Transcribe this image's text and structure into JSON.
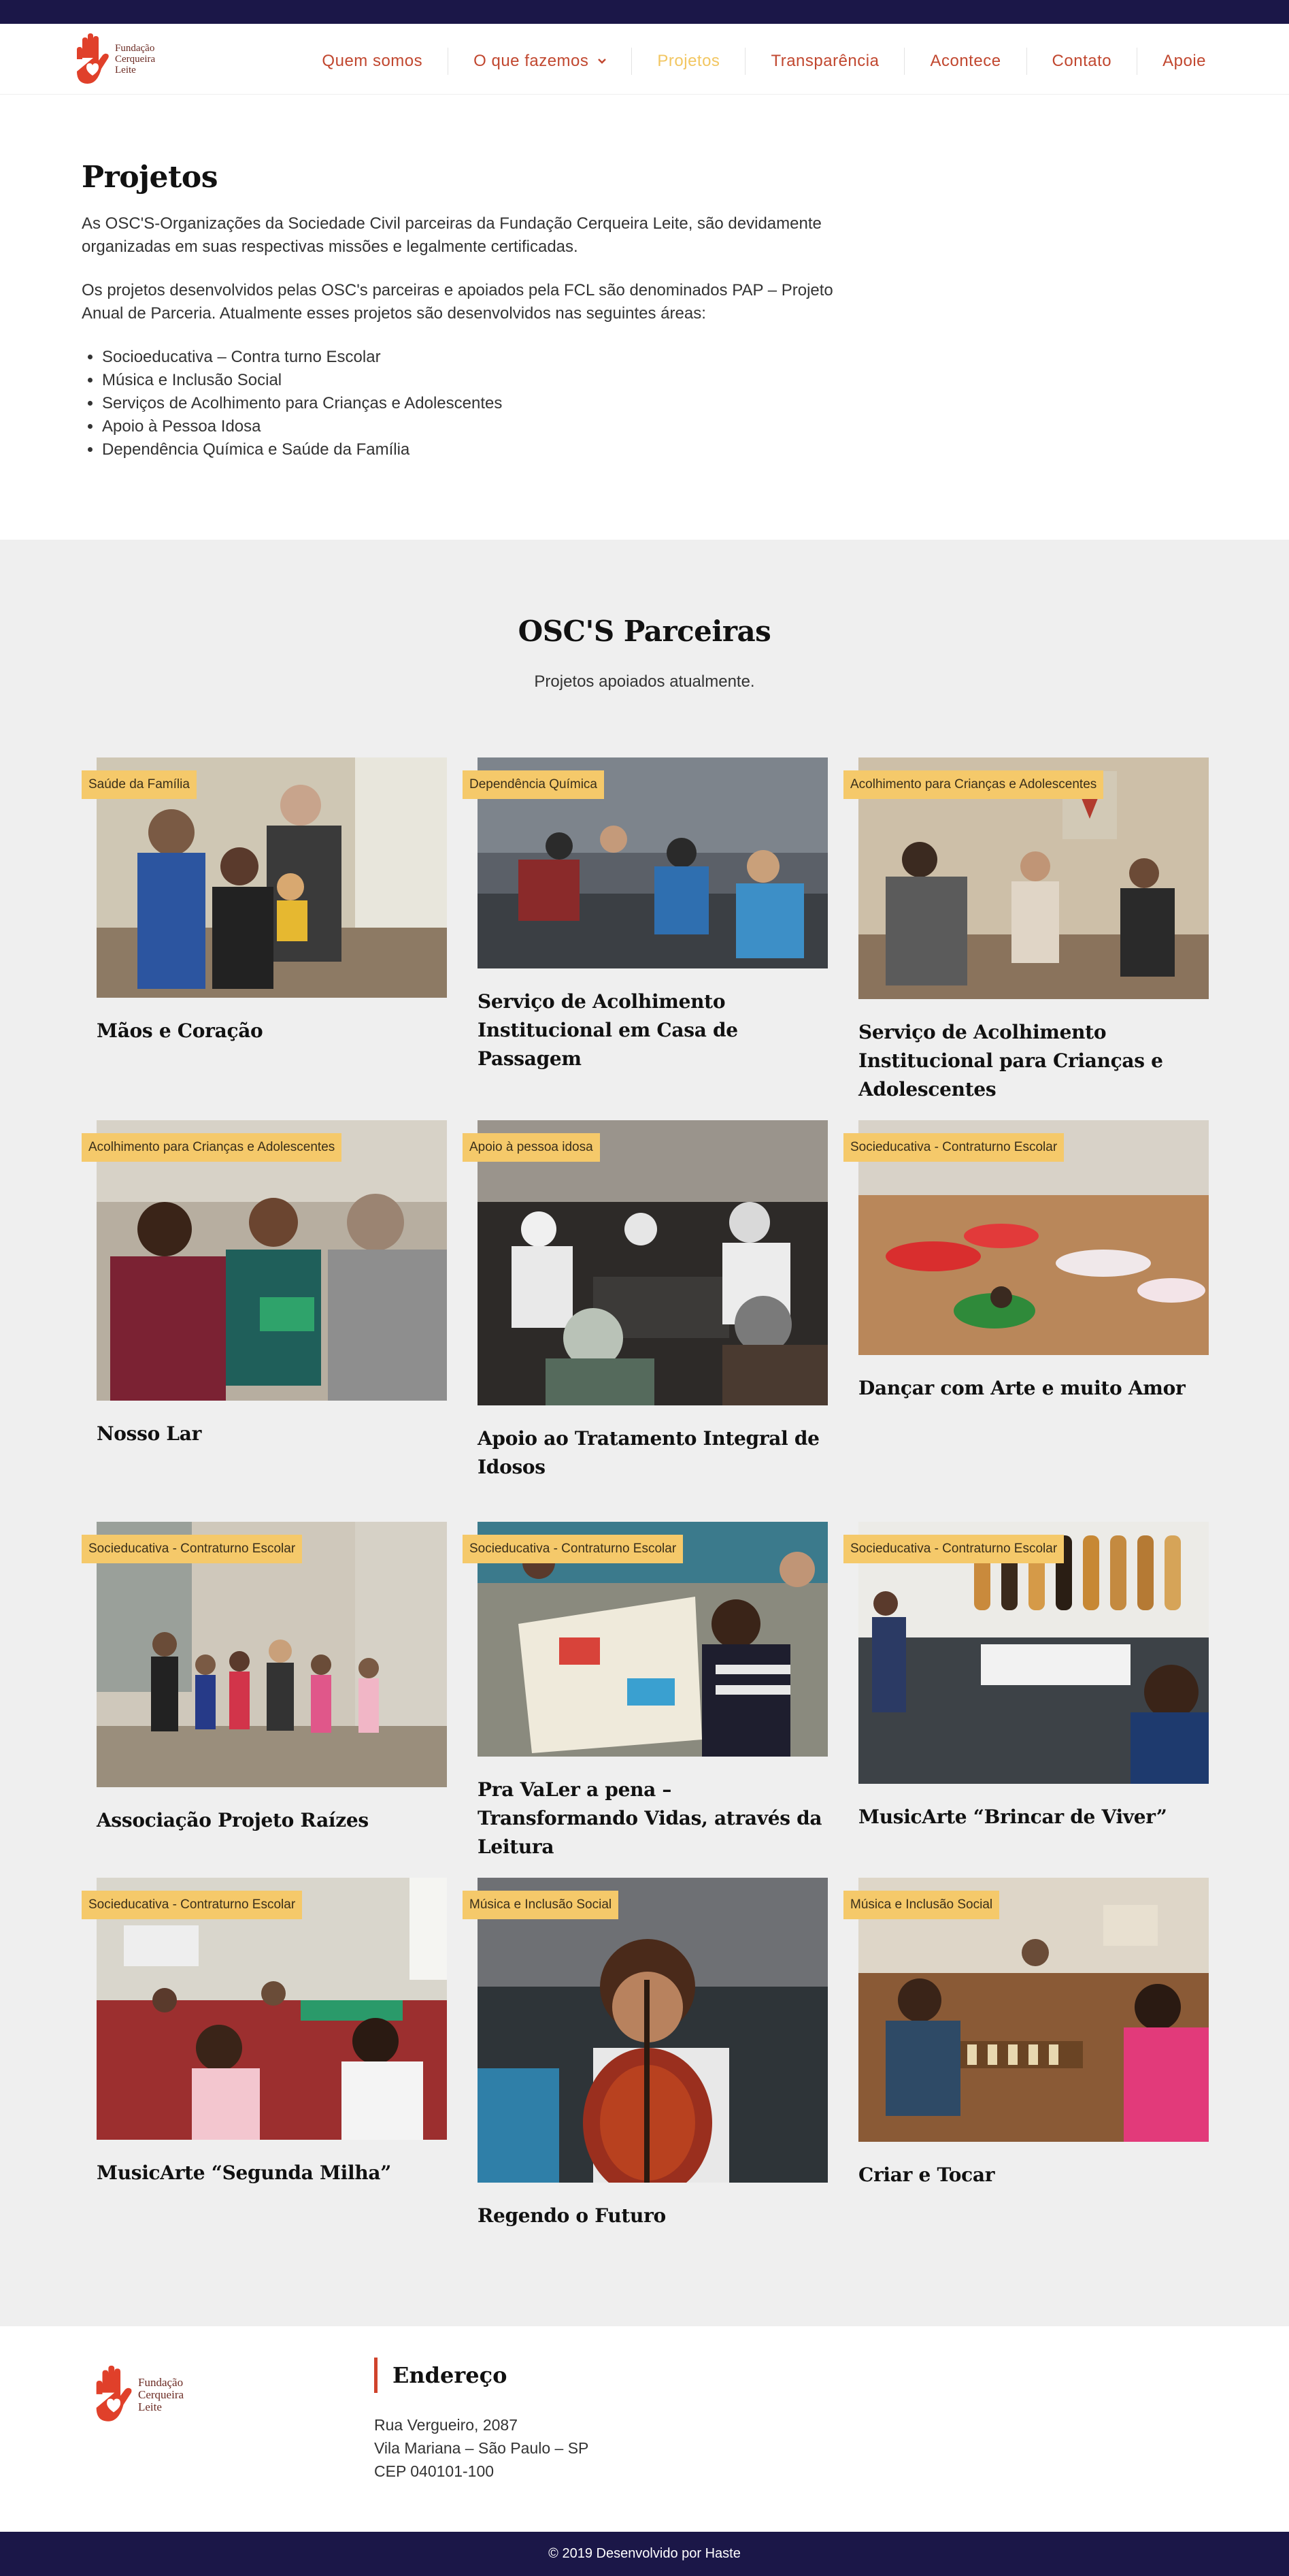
{
  "header": {
    "logo_text": [
      "Fundação",
      "Cerqueira",
      "Leite"
    ],
    "nav": [
      {
        "label": "Quem somos",
        "active": false
      },
      {
        "label": "O que fazemos",
        "active": false,
        "dropdown": true
      },
      {
        "label": "Projetos",
        "active": true
      },
      {
        "label": "Transparência",
        "active": false
      },
      {
        "label": "Acontece",
        "active": false
      },
      {
        "label": "Contato",
        "active": false
      },
      {
        "label": "Apoie",
        "active": false
      }
    ]
  },
  "intro": {
    "title": "Projetos",
    "paragraph1": "As OSC'S-Organizações da Sociedade Civil parceiras da Fundação Cerqueira Leite, são devidamente organizadas em suas respectivas missões e legalmente certificadas.",
    "paragraph2": "Os projetos desenvolvidos pelas OSC's parceiras e apoiados pela FCL são denominados PAP – Projeto Anual de Parceria. Atualmente esses projetos são desenvolvidos nas seguintes áreas:",
    "areas": [
      "Socioeducativa – Contra turno Escolar",
      "Música e Inclusão Social",
      "Serviços de Acolhimento para Crianças e Adolescentes",
      "Apoio à Pessoa Idosa",
      "Dependência Química e Saúde da Família"
    ]
  },
  "partners": {
    "title": "OSC'S Parceiras",
    "subtitle": "Projetos apoiados atualmente.",
    "cards": [
      {
        "tag": "Saúde da Família",
        "title": "Mãos e Coração"
      },
      {
        "tag": "Dependência Química",
        "title": "Serviço de Acolhimento Institucional em Casa de Passagem"
      },
      {
        "tag": "Acolhimento para Crianças e Adolescentes",
        "title": "Serviço de Acolhimento Institucional para Crianças e Adolescentes"
      },
      {
        "tag": "Acolhimento para Crianças e Adolescentes",
        "title": "Nosso Lar"
      },
      {
        "tag": "Apoio à pessoa idosa",
        "title": "Apoio ao Tratamento Integral de Idosos"
      },
      {
        "tag": "Socieducativa - Contraturno Escolar",
        "title": "Dançar com Arte e muito Amor"
      },
      {
        "tag": "Socieducativa - Contraturno Escolar",
        "title": "Associação Projeto Raízes"
      },
      {
        "tag": "Socieducativa - Contraturno Escolar",
        "title": "Pra VaLer a pena – Transformando Vidas, através da Leitura"
      },
      {
        "tag": "Socieducativa - Contraturno Escolar",
        "title": "MusicArte “Brincar de Viver”"
      },
      {
        "tag": "Socieducativa - Contraturno Escolar",
        "title": "MusicArte “Segunda Milha”"
      },
      {
        "tag": "Música e Inclusão Social",
        "title": "Regendo o Futuro"
      },
      {
        "tag": "Música e Inclusão Social",
        "title": "Criar e Tocar"
      }
    ]
  },
  "footer": {
    "logo_text": [
      "Fundação",
      "Cerqueira",
      "Leite"
    ],
    "address_title": "Endereço",
    "address_lines": [
      "Rua Vergueiro, 2087",
      "Vila Mariana – São Paulo – SP",
      "CEP 040101-100"
    ],
    "copyright": "© 2019 Desenvolvido por Haste"
  },
  "colors": {
    "dark_bar": "#1b1748",
    "nav_link": "#c1472f",
    "nav_active": "#f2c661",
    "tag_bg": "#f5c96a",
    "accent_line": "#d0432c",
    "section_bg": "#efefef"
  }
}
